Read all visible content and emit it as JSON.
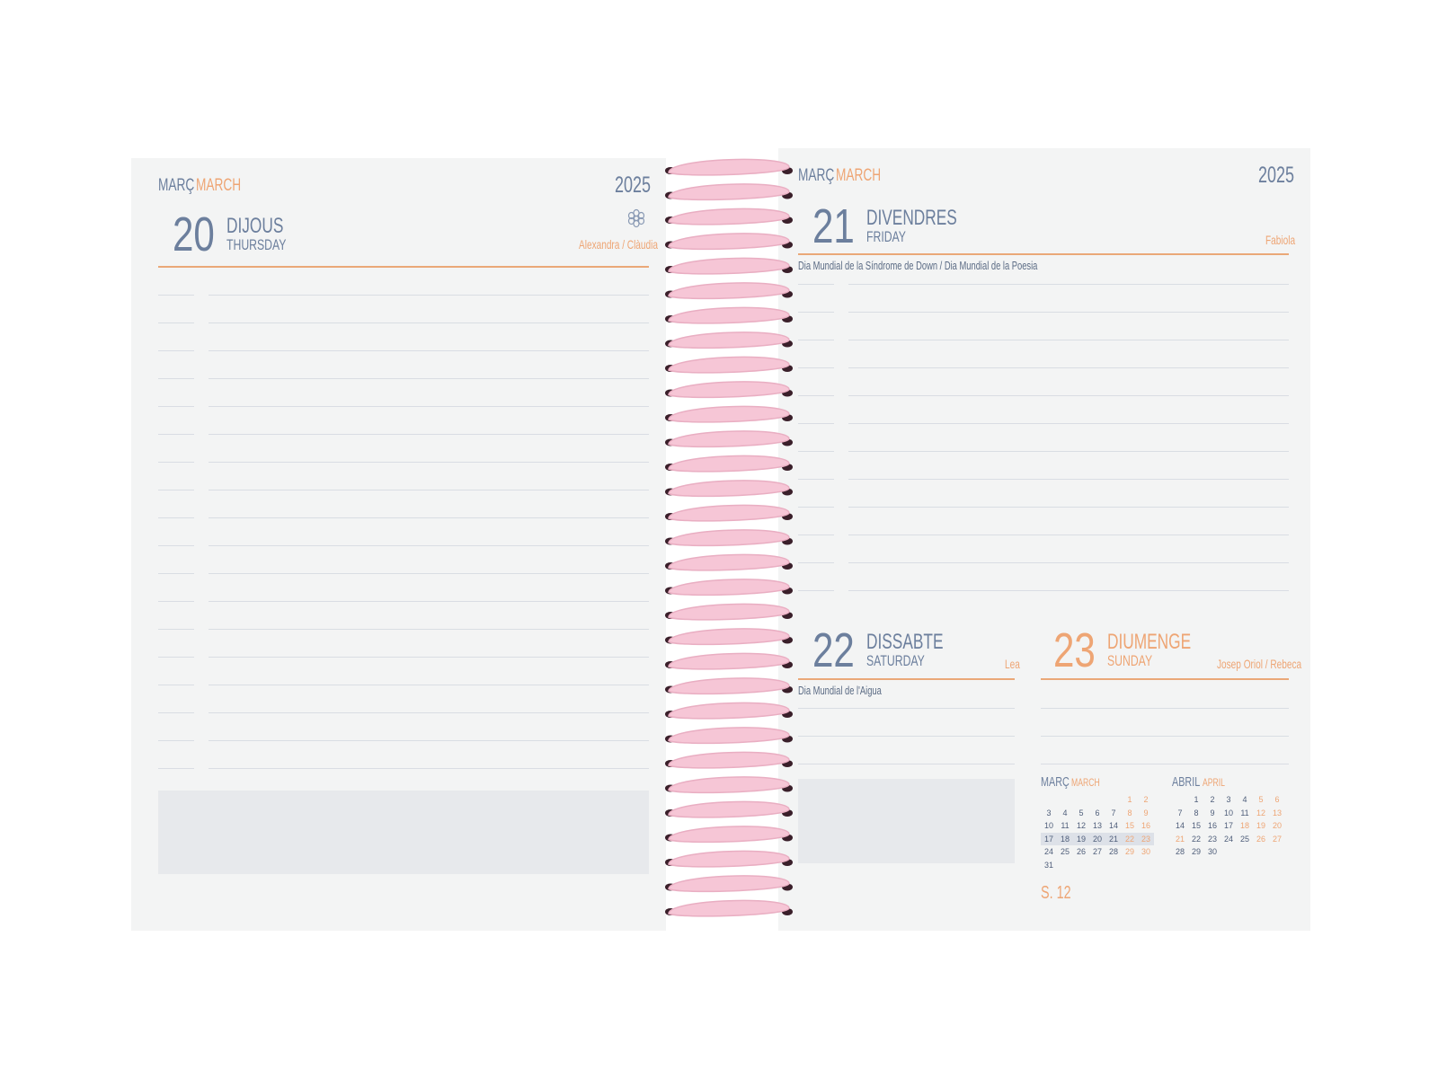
{
  "left_page": {
    "month_ca": "MARÇ",
    "month_en": "MARCH",
    "year": "2025",
    "day": {
      "number": "20",
      "name_ca": "DIJOUS",
      "name_en": "THURSDAY",
      "saints": "Alexandra / Clàudia",
      "icon": "flower-icon"
    }
  },
  "right_page": {
    "month_ca": "MARÇ",
    "month_en": "MARCH",
    "year": "2025",
    "day21": {
      "number": "21",
      "name_ca": "DIVENDRES",
      "name_en": "FRIDAY",
      "saints": "Fabiola",
      "event": "Dia Mundial de la Síndrome de Down / Dia Mundial de la Poesia"
    },
    "day22": {
      "number": "22",
      "name_ca": "DISSABTE",
      "name_en": "SATURDAY",
      "saints": "Lea",
      "event": "Dia Mundial de l'Aigua"
    },
    "day23": {
      "number": "23",
      "name_ca": "DIUMENGE",
      "name_en": "SUNDAY",
      "saints": "Josep Oriol / Rebeca"
    },
    "mini_calendars": [
      {
        "title_ca": "MARÇ",
        "title_en": "MARCH",
        "leading_blanks": 5,
        "days": [
          "1",
          "2",
          "3",
          "4",
          "5",
          "6",
          "7",
          "8",
          "9",
          "10",
          "11",
          "12",
          "13",
          "14",
          "15",
          "16",
          "17",
          "18",
          "19",
          "20",
          "21",
          "22",
          "23",
          "24",
          "25",
          "26",
          "27",
          "28",
          "29",
          "30",
          "31"
        ],
        "weekend": [
          "1",
          "2",
          "8",
          "9",
          "15",
          "16",
          "22",
          "23",
          "29",
          "30"
        ],
        "highlight": [
          "17",
          "18",
          "19",
          "20",
          "21",
          "22",
          "23"
        ]
      },
      {
        "title_ca": "ABRIL",
        "title_en": "APRIL",
        "leading_blanks": 1,
        "days": [
          "1",
          "2",
          "3",
          "4",
          "5",
          "6",
          "7",
          "8",
          "9",
          "10",
          "11",
          "12",
          "13",
          "14",
          "15",
          "16",
          "17",
          "18",
          "19",
          "20",
          "21",
          "22",
          "23",
          "24",
          "25",
          "26",
          "27",
          "28",
          "29",
          "30"
        ],
        "weekend": [
          "5",
          "6",
          "12",
          "13",
          "18",
          "19",
          "20",
          "21",
          "26",
          "27"
        ],
        "highlight": []
      }
    ],
    "week_label": "S. 12"
  },
  "colors": {
    "accent": "#eea574",
    "slate": "#6c7f9d",
    "binding": "#f6c6d6"
  }
}
